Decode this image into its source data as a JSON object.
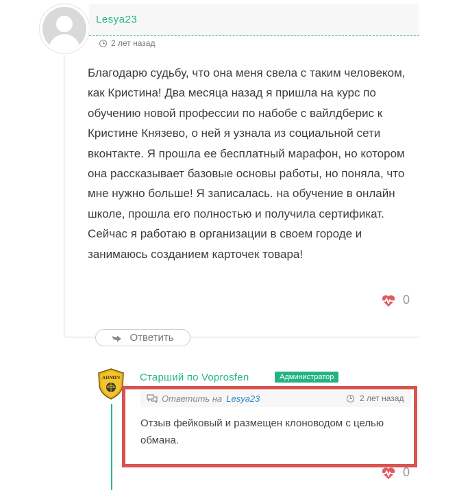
{
  "comment1": {
    "author": "Lesya23",
    "time": "2 лет назад",
    "body": "Благодарю судьбу, что она меня свела с таким человеком, как Кристина! Два месяца назад я пришла на курс по обучению новой профессии по набобе с вайлдберис к Кристине Князево, о ней я узнала из социальной сети вконтакте. Я прошла ее бесплатный марафон, но котором она рассказывает базовые основы работы, но поняла, что мне нужно больше! Я записалась. на обучение в онлайн школе, прошла его полностью и получила сертификат. Сейчас я работаю в организации в своем городе и занимаюсь созданием карточек товара!",
    "likes": "0",
    "reply_button": "Ответить"
  },
  "comment2": {
    "avatar_text": "ADMIN",
    "author": "Старший по Voprosfen",
    "badge": "Администратор",
    "reply_prefix": "Ответить на",
    "reply_to": "Lesya23",
    "time": "2 лет назад",
    "body": "Отзыв фейковый и размещен клоноводом с целью обмана.",
    "likes": "0"
  },
  "colors": {
    "accent": "#24b383",
    "heart": "#e05a62",
    "highlight_border": "#d9534f",
    "link": "#2b87c9"
  },
  "icons": [
    "user-avatar-placeholder",
    "clock-icon",
    "heart-pulse-icon",
    "reply-arrow-icon",
    "admin-shield-avatar",
    "speech-bubbles-icon"
  ]
}
